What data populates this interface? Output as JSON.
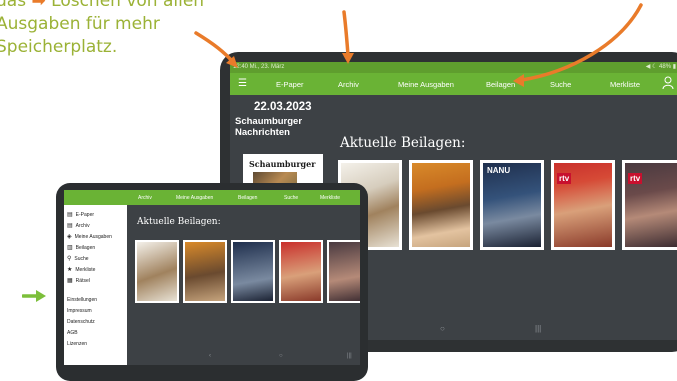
{
  "caption": {
    "line1_prefix": "das",
    "line1_suffix": "Löschen von allen",
    "line2": "Ausgaben für mehr",
    "line3": "Speicherplatz."
  },
  "big_tablet": {
    "statusbar": {
      "left": "12:40  Mi., 23. März",
      "right": "◀ ☾ 48% ▮"
    },
    "nav": {
      "menu_icon": "menu-icon",
      "items": [
        "E-Paper",
        "Archiv",
        "Meine Ausgaben",
        "Beilagen",
        "Suche",
        "Merkliste"
      ],
      "user_icon": "user-icon"
    },
    "date": "22.03.2023",
    "paper_name_1": "Schaumburger",
    "paper_name_2": "Nachrichten",
    "frontpage_masthead": "Schaumburger",
    "heading": "Aktuelle Beilagen:",
    "tile_badges": [
      "",
      "",
      "NANU",
      "rtv",
      "rtv"
    ],
    "bottom_nav": [
      "○",
      "|||"
    ]
  },
  "small_tablet": {
    "nav_items": [
      "Archiv",
      "Meine Ausgaben",
      "Beilagen",
      "Suche",
      "Merkliste"
    ],
    "sidebar_items": [
      {
        "icon": "▤",
        "label": "E-Paper"
      },
      {
        "icon": "▤",
        "label": "Archiv"
      },
      {
        "icon": "◈",
        "label": "Meine Ausgaben"
      },
      {
        "icon": "▥",
        "label": "Beilagen"
      },
      {
        "icon": "⚲",
        "label": "Suche"
      },
      {
        "icon": "★",
        "label": "Merkliste"
      },
      {
        "icon": "▦",
        "label": "Rätsel"
      }
    ],
    "sidebar_links": [
      "Einstellungen",
      "Impressum",
      "Datenschutz",
      "AGB",
      "Lizenzen"
    ],
    "heading": "Aktuelle Beilagen:",
    "bottom_nav": [
      "‹",
      "○",
      "|||"
    ]
  },
  "colors": {
    "accent_green": "#6ab335",
    "arrow_orange": "#e97b2a",
    "caption_green": "#9bb236"
  }
}
